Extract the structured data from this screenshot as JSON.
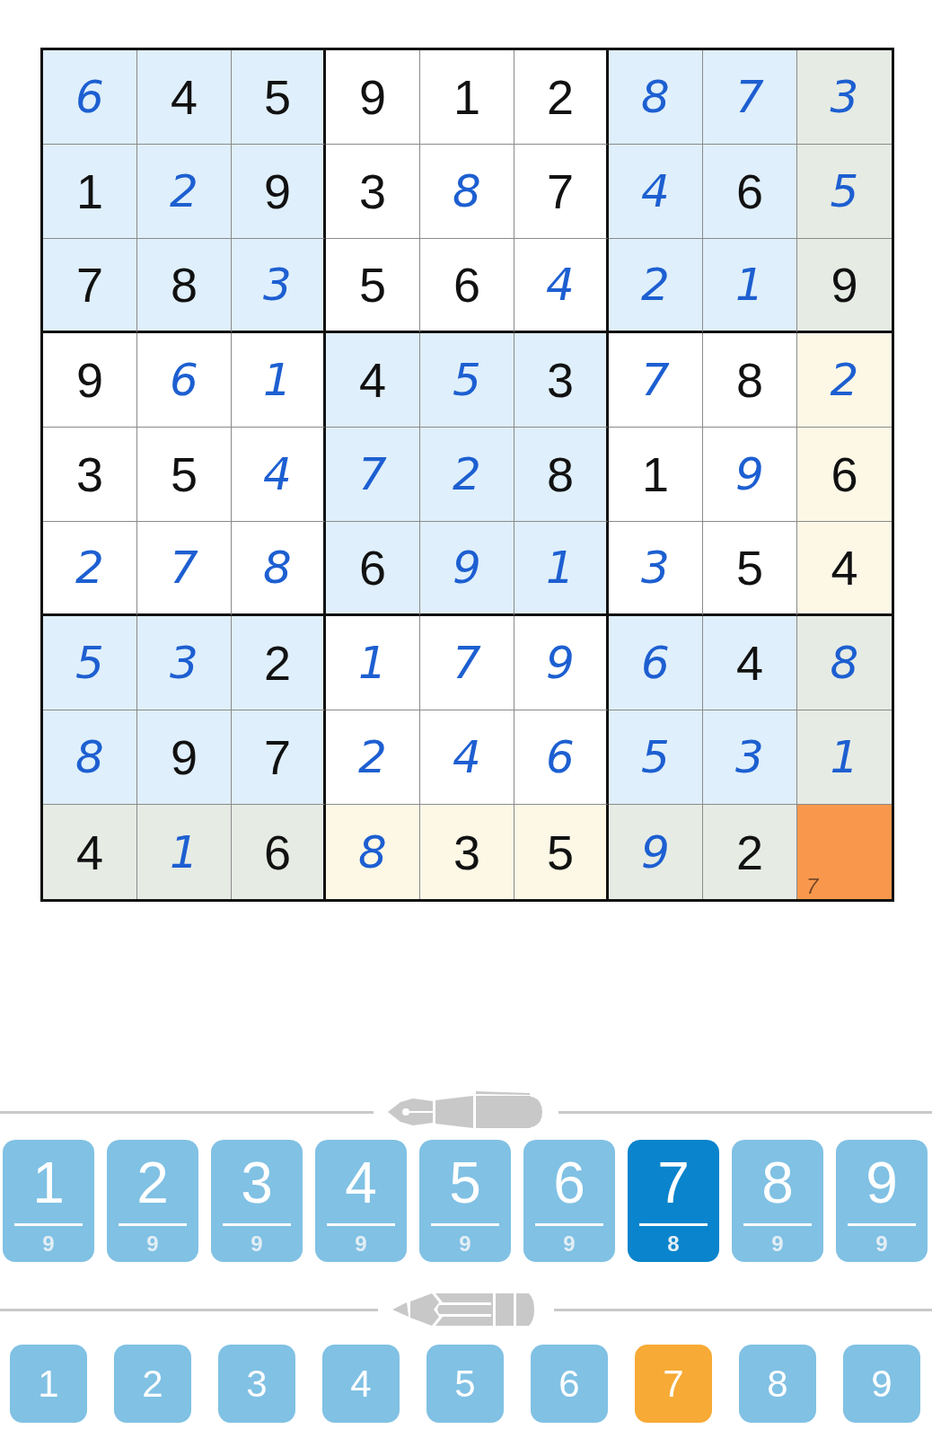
{
  "grid": {
    "rows": [
      [
        {
          "value": "6",
          "entered": true,
          "selected": false
        },
        {
          "value": "4",
          "entered": false,
          "selected": false
        },
        {
          "value": "5",
          "entered": false,
          "selected": false
        },
        {
          "value": "9",
          "entered": false,
          "selected": false
        },
        {
          "value": "1",
          "entered": false,
          "selected": false
        },
        {
          "value": "2",
          "entered": false,
          "selected": false
        },
        {
          "value": "8",
          "entered": true,
          "selected": false
        },
        {
          "value": "7",
          "entered": true,
          "selected": false
        },
        {
          "value": "3",
          "entered": true,
          "selected": false
        }
      ],
      [
        {
          "value": "1",
          "entered": false,
          "selected": false
        },
        {
          "value": "2",
          "entered": true,
          "selected": false
        },
        {
          "value": "9",
          "entered": false,
          "selected": false
        },
        {
          "value": "3",
          "entered": false,
          "selected": false
        },
        {
          "value": "8",
          "entered": true,
          "selected": false
        },
        {
          "value": "7",
          "entered": false,
          "selected": false
        },
        {
          "value": "4",
          "entered": true,
          "selected": false
        },
        {
          "value": "6",
          "entered": false,
          "selected": false
        },
        {
          "value": "5",
          "entered": true,
          "selected": false
        }
      ],
      [
        {
          "value": "7",
          "entered": false,
          "selected": false
        },
        {
          "value": "8",
          "entered": false,
          "selected": false
        },
        {
          "value": "3",
          "entered": true,
          "selected": false
        },
        {
          "value": "5",
          "entered": false,
          "selected": false
        },
        {
          "value": "6",
          "entered": false,
          "selected": false
        },
        {
          "value": "4",
          "entered": true,
          "selected": false
        },
        {
          "value": "2",
          "entered": true,
          "selected": false
        },
        {
          "value": "1",
          "entered": true,
          "selected": false
        },
        {
          "value": "9",
          "entered": false,
          "selected": false
        }
      ],
      [
        {
          "value": "9",
          "entered": false,
          "selected": false
        },
        {
          "value": "6",
          "entered": true,
          "selected": false
        },
        {
          "value": "1",
          "entered": true,
          "selected": false
        },
        {
          "value": "4",
          "entered": false,
          "selected": false
        },
        {
          "value": "5",
          "entered": true,
          "selected": false
        },
        {
          "value": "3",
          "entered": false,
          "selected": false
        },
        {
          "value": "7",
          "entered": true,
          "selected": false
        },
        {
          "value": "8",
          "entered": false,
          "selected": false
        },
        {
          "value": "2",
          "entered": true,
          "selected": false
        }
      ],
      [
        {
          "value": "3",
          "entered": false,
          "selected": false
        },
        {
          "value": "5",
          "entered": false,
          "selected": false
        },
        {
          "value": "4",
          "entered": true,
          "selected": false
        },
        {
          "value": "7",
          "entered": true,
          "selected": false
        },
        {
          "value": "2",
          "entered": true,
          "selected": false
        },
        {
          "value": "8",
          "entered": false,
          "selected": false
        },
        {
          "value": "1",
          "entered": false,
          "selected": false
        },
        {
          "value": "9",
          "entered": true,
          "selected": false
        },
        {
          "value": "6",
          "entered": false,
          "selected": false
        }
      ],
      [
        {
          "value": "2",
          "entered": true,
          "selected": false
        },
        {
          "value": "7",
          "entered": true,
          "selected": false
        },
        {
          "value": "8",
          "entered": true,
          "selected": false
        },
        {
          "value": "6",
          "entered": false,
          "selected": false
        },
        {
          "value": "9",
          "entered": true,
          "selected": false
        },
        {
          "value": "1",
          "entered": true,
          "selected": false
        },
        {
          "value": "3",
          "entered": true,
          "selected": false
        },
        {
          "value": "5",
          "entered": false,
          "selected": false
        },
        {
          "value": "4",
          "entered": false,
          "selected": false
        }
      ],
      [
        {
          "value": "5",
          "entered": true,
          "selected": false
        },
        {
          "value": "3",
          "entered": true,
          "selected": false
        },
        {
          "value": "2",
          "entered": false,
          "selected": false
        },
        {
          "value": "1",
          "entered": true,
          "selected": false
        },
        {
          "value": "7",
          "entered": true,
          "selected": false
        },
        {
          "value": "9",
          "entered": true,
          "selected": false
        },
        {
          "value": "6",
          "entered": true,
          "selected": false
        },
        {
          "value": "4",
          "entered": false,
          "selected": false
        },
        {
          "value": "8",
          "entered": true,
          "selected": false
        }
      ],
      [
        {
          "value": "8",
          "entered": true,
          "selected": false
        },
        {
          "value": "9",
          "entered": false,
          "selected": false
        },
        {
          "value": "7",
          "entered": false,
          "selected": false
        },
        {
          "value": "2",
          "entered": true,
          "selected": false
        },
        {
          "value": "4",
          "entered": true,
          "selected": false
        },
        {
          "value": "6",
          "entered": true,
          "selected": false
        },
        {
          "value": "5",
          "entered": true,
          "selected": false
        },
        {
          "value": "3",
          "entered": true,
          "selected": false
        },
        {
          "value": "1",
          "entered": true,
          "selected": false
        }
      ],
      [
        {
          "value": "4",
          "entered": false,
          "selected": false
        },
        {
          "value": "1",
          "entered": true,
          "selected": false
        },
        {
          "value": "6",
          "entered": false,
          "selected": false
        },
        {
          "value": "8",
          "entered": true,
          "selected": false
        },
        {
          "value": "3",
          "entered": false,
          "selected": false
        },
        {
          "value": "5",
          "entered": false,
          "selected": false
        },
        {
          "value": "9",
          "entered": true,
          "selected": false
        },
        {
          "value": "2",
          "entered": false,
          "selected": false
        },
        {
          "notes": [
            "7"
          ],
          "selected": true
        }
      ]
    ]
  },
  "pen_keys": [
    {
      "digit": "1",
      "count": "9",
      "selected": false
    },
    {
      "digit": "2",
      "count": "9",
      "selected": false
    },
    {
      "digit": "3",
      "count": "9",
      "selected": false
    },
    {
      "digit": "4",
      "count": "9",
      "selected": false
    },
    {
      "digit": "5",
      "count": "9",
      "selected": false
    },
    {
      "digit": "6",
      "count": "9",
      "selected": false
    },
    {
      "digit": "7",
      "count": "8",
      "selected": true
    },
    {
      "digit": "8",
      "count": "9",
      "selected": false
    },
    {
      "digit": "9",
      "count": "9",
      "selected": false
    }
  ],
  "pencil_keys": [
    {
      "digit": "1",
      "selected": false
    },
    {
      "digit": "2",
      "selected": false
    },
    {
      "digit": "3",
      "selected": false
    },
    {
      "digit": "4",
      "selected": false
    },
    {
      "digit": "5",
      "selected": false
    },
    {
      "digit": "6",
      "selected": false
    },
    {
      "digit": "7",
      "selected": true
    },
    {
      "digit": "8",
      "selected": false
    },
    {
      "digit": "9",
      "selected": false
    }
  ]
}
